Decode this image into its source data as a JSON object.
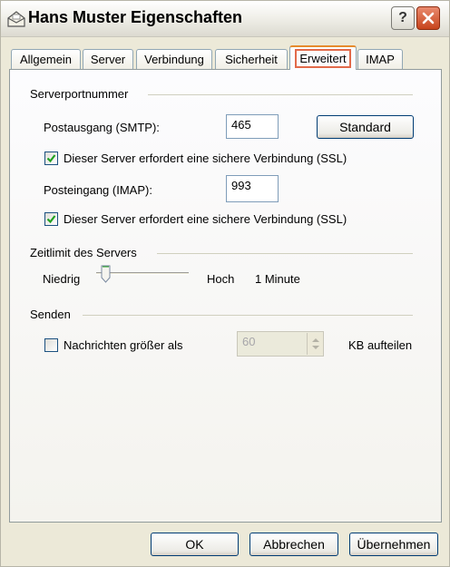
{
  "window": {
    "title": "Hans Muster Eigenschaften",
    "title_icon": "mail-account-icon",
    "help_label": "?",
    "close_label": "✕"
  },
  "tabs": [
    {
      "label": "Allgemein",
      "active": false
    },
    {
      "label": "Server",
      "active": false
    },
    {
      "label": "Verbindung",
      "active": false
    },
    {
      "label": "Sicherheit",
      "active": false
    },
    {
      "label": "Erweitert",
      "active": true
    },
    {
      "label": "IMAP",
      "active": false
    }
  ],
  "serverports": {
    "group_label": "Serverportnummer",
    "smtp_label": "Postausgang (SMTP):",
    "smtp_value": "465",
    "standard_button": "Standard",
    "smtp_ssl_label": "Dieser Server erfordert eine sichere Verbindung (SSL)",
    "smtp_ssl_checked": true,
    "imap_label": "Posteingang (IMAP):",
    "imap_value": "993",
    "imap_ssl_label": "Dieser Server erfordert eine sichere Verbindung (SSL)",
    "imap_ssl_checked": true
  },
  "timeout": {
    "group_label": "Zeitlimit des Servers",
    "low_label": "Niedrig",
    "high_label": "Hoch",
    "value_label": "1 Minute",
    "slider_level": 0.1
  },
  "send": {
    "group_label": "Senden",
    "split_label": "Nachrichten größer als",
    "split_checked": false,
    "size_value": "60",
    "unit_label": "KB aufteilen"
  },
  "footer": {
    "ok": "OK",
    "cancel": "Abbrechen",
    "apply": "Übernehmen"
  },
  "colors": {
    "accent_tab_highlight": "#e26a4a",
    "checkmark": "#21a121",
    "close_button": "#c7441c"
  }
}
